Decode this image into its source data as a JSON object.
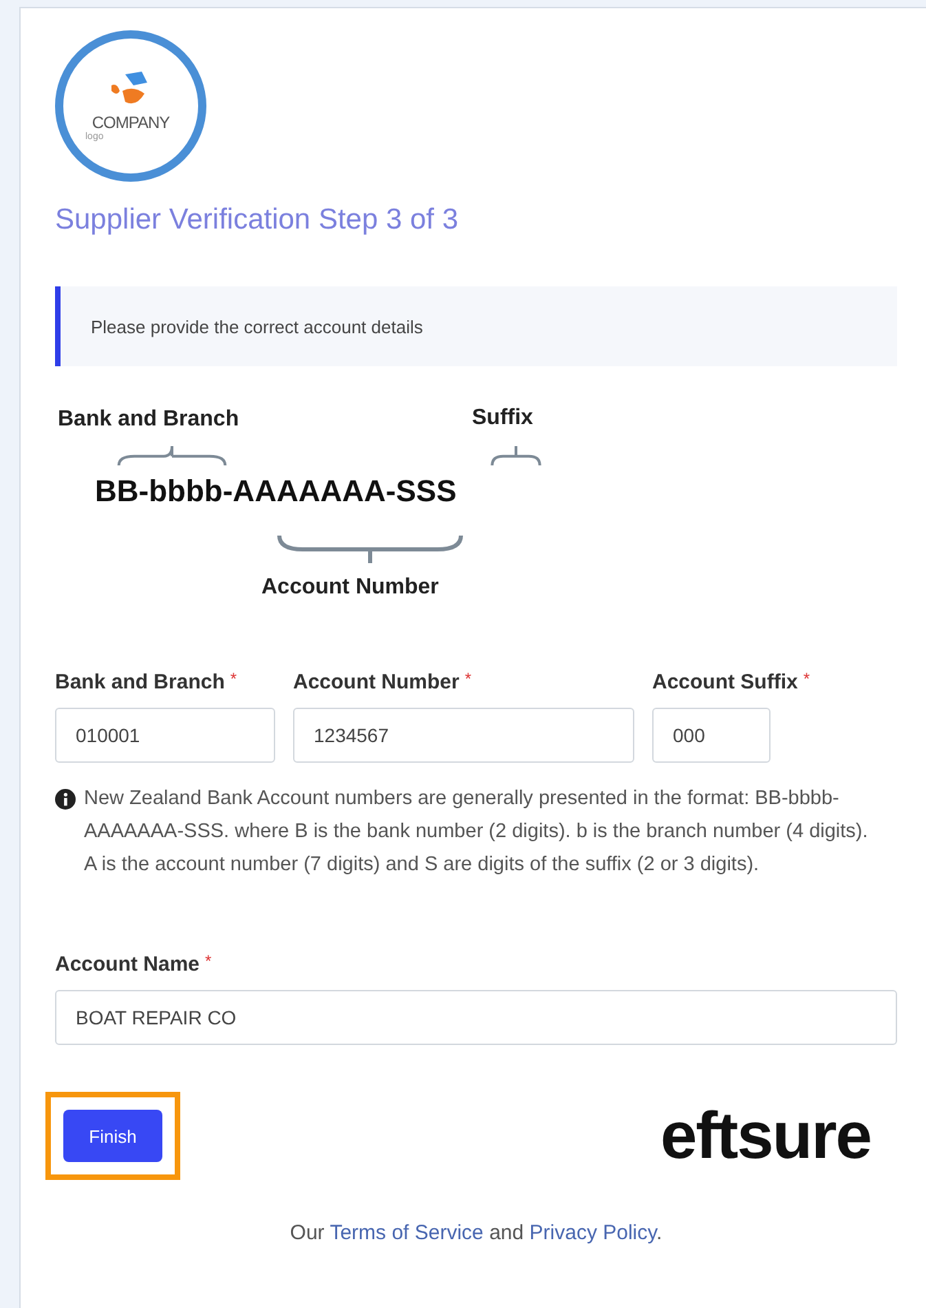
{
  "logo": {
    "name": "COMPANY",
    "tagline": "logo"
  },
  "title": "Supplier Verification Step 3 of 3",
  "alert": {
    "text": "Please provide the correct account details"
  },
  "diagram": {
    "bank_label": "Bank and Branch",
    "suffix_label": "Suffix",
    "format": "BB-bbbb-AAAAAAA-SSS",
    "account_label": "Account Number"
  },
  "account_fields": [
    {
      "label": "Bank and Branch",
      "required_mark": "*",
      "value": "010001"
    },
    {
      "label": "Account Number",
      "required_mark": "*",
      "value": "1234567"
    },
    {
      "label": "Account Suffix",
      "required_mark": "*",
      "value": "000"
    }
  ],
  "hint": "New Zealand Bank Account numbers are generally presented in the format: BB-bbbb-AAAAAAA-SSS. where B is the bank number (2 digits). b is the branch number (4 digits). A is the account number (7 digits) and S are digits of the suffix (2 or 3 digits).",
  "name_field": {
    "label": "Account Name",
    "required_mark": "*",
    "value": "BOAT REPAIR CO"
  },
  "finish_button": {
    "label": "Finish",
    "highlighted": true
  },
  "brand": "eftsure",
  "footer": [
    {
      "kind": "text",
      "text": "Our "
    },
    {
      "kind": "link",
      "text": "Terms of Service"
    },
    {
      "kind": "text",
      "text": " and "
    },
    {
      "kind": "link",
      "text": "Privacy Policy"
    },
    {
      "kind": "text",
      "text": "."
    }
  ]
}
